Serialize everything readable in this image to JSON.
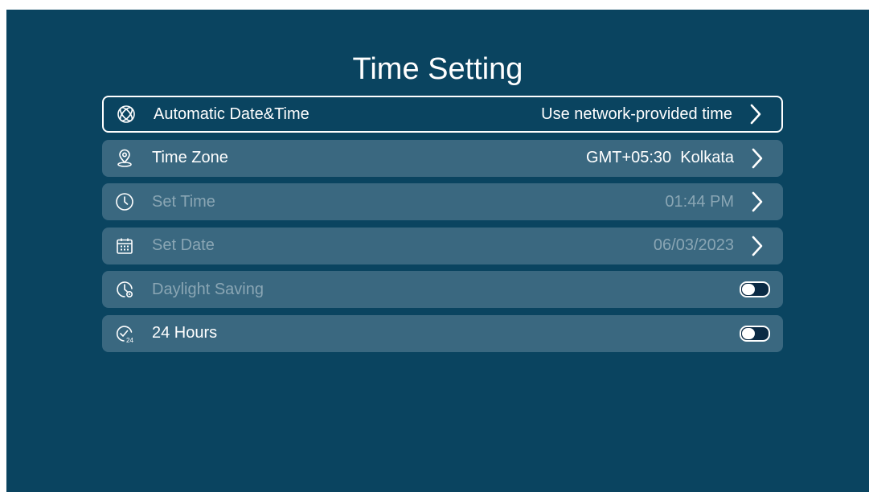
{
  "page": {
    "title": "Time Setting"
  },
  "settings": [
    {
      "label": "Automatic Date&Time",
      "value": "Use network-provided time",
      "icon": "globe-icon",
      "state": "focused"
    },
    {
      "label": "Time Zone",
      "value": "GMT+05:30  Kolkata",
      "icon": "location-pin-icon",
      "state": "enabled"
    },
    {
      "label": "Set Time",
      "value": "01:44 PM",
      "icon": "clock-icon",
      "state": "disabled"
    },
    {
      "label": "Set Date",
      "value": "06/03/2023",
      "icon": "calendar-icon",
      "state": "disabled"
    },
    {
      "label": "Daylight Saving",
      "toggle": false,
      "icon": "daylight-clock-icon",
      "state": "disabled"
    },
    {
      "label": "24 Hours",
      "toggle": false,
      "icon": "clock-24-icon",
      "state": "enabled"
    }
  ],
  "colors": {
    "background": "#0a4460",
    "row": "#3a6880",
    "text": "#ffffff",
    "disabled_text": "#8aa6b4"
  }
}
